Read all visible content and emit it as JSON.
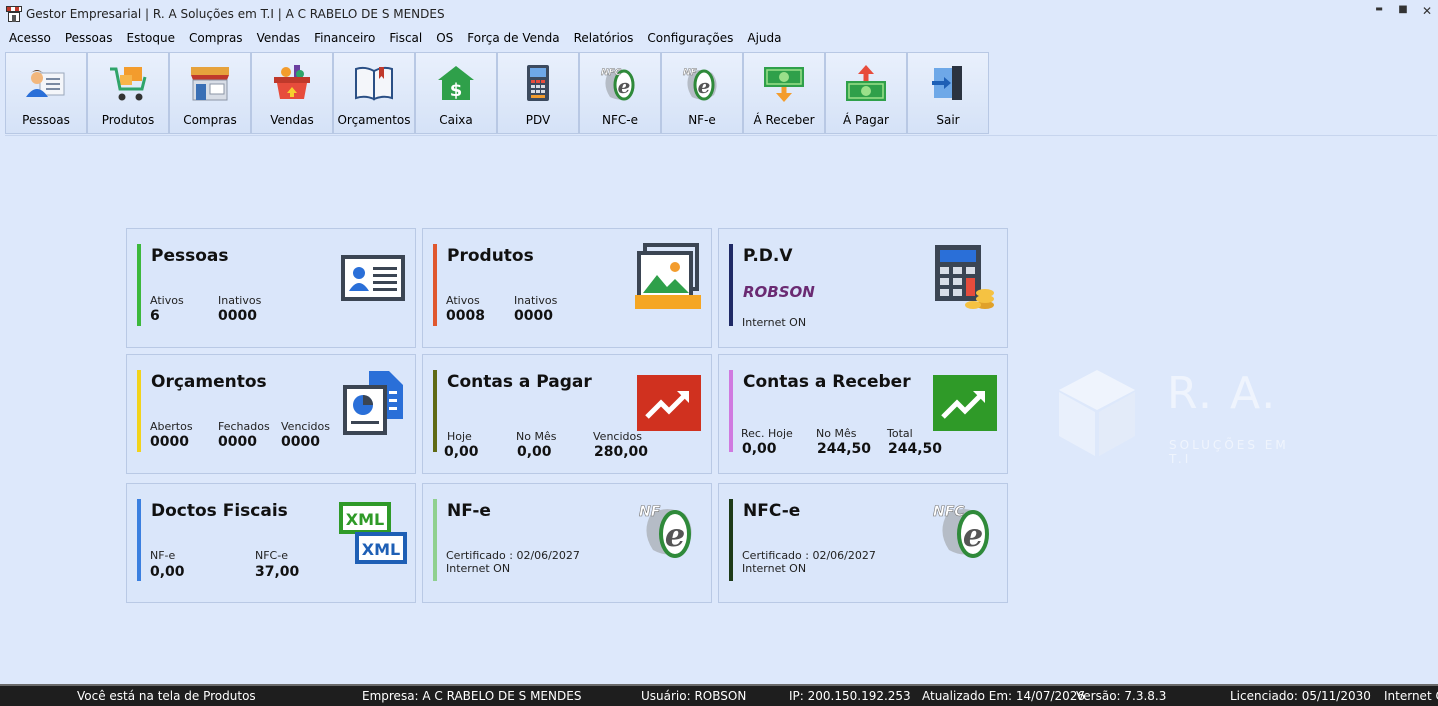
{
  "window": {
    "title": "Gestor Empresarial | R. A Soluções em T.I | A C RABELO DE S MENDES",
    "minimize": "▬",
    "maximize": "■",
    "close": "✕"
  },
  "menu": [
    "Acesso",
    "Pessoas",
    "Estoque",
    "Compras",
    "Vendas",
    "Financeiro",
    "Fiscal",
    "OS",
    "Força de Venda",
    "Relatórios",
    "Configurações",
    "Ajuda"
  ],
  "toolbar": [
    {
      "label": "Pessoas",
      "icon": "person-card-icon"
    },
    {
      "label": "Produtos",
      "icon": "shopping-cart-icon"
    },
    {
      "label": "Compras",
      "icon": "store-icon"
    },
    {
      "label": "Vendas",
      "icon": "basket-icon"
    },
    {
      "label": "Orçamentos",
      "icon": "book-icon"
    },
    {
      "label": "Caixa",
      "icon": "cash-house-icon"
    },
    {
      "label": "PDV",
      "icon": "pos-terminal-icon"
    },
    {
      "label": "NFC-e",
      "icon": "nfce-logo-icon"
    },
    {
      "label": "NF-e",
      "icon": "nfe-logo-icon"
    },
    {
      "label": "Á Receber",
      "icon": "receive-money-icon"
    },
    {
      "label": "Á Pagar",
      "icon": "pay-money-icon"
    },
    {
      "label": "Sair",
      "icon": "exit-icon"
    }
  ],
  "toolbar_logo_text": {
    "nfce": "NFC",
    "nfe": "NF",
    "e": "e"
  },
  "cards": {
    "pessoas": {
      "title": "Pessoas",
      "ativos_label": "Ativos",
      "ativos": "6",
      "inativos_label": "Inativos",
      "inativos": "0000",
      "color": "#3cb83c"
    },
    "produtos": {
      "title": "Produtos",
      "ativos_label": "Ativos",
      "ativos": "0008",
      "inativos_label": "Inativos",
      "inativos": "0000",
      "color": "#e0572e"
    },
    "pdv": {
      "title": "P.D.V",
      "user": "ROBSON",
      "internet": "Internet ON",
      "color": "#1f2a66"
    },
    "orcamentos": {
      "title": "Orçamentos",
      "abertos_label": "Abertos",
      "abertos": "0000",
      "fechados_label": "Fechados",
      "fechados": "0000",
      "vencidos_label": "Vencidos",
      "vencidos": "0000",
      "color": "#f2d31b"
    },
    "contas_pagar": {
      "title": "Contas a Pagar",
      "hoje_label": "Hoje",
      "hoje": "0,00",
      "mes_label": "No Mês",
      "mes": "0,00",
      "vencidos_label": "Vencidos",
      "vencidos": "280,00",
      "color": "#5f6a14"
    },
    "contas_receber": {
      "title": "Contas a Receber",
      "hoje_label": "Rec. Hoje",
      "hoje": "0,00",
      "mes_label": "No Mês",
      "mes": "244,50",
      "total_label": "Total",
      "total": "244,50",
      "color": "#d07ae0"
    },
    "doctos": {
      "title": "Doctos Fiscais",
      "nfe_label": "NF-e",
      "nfe": "0,00",
      "nfce_label": "NFC-e",
      "nfce": "37,00",
      "color": "#3a7fe0",
      "xml": "XML"
    },
    "nfe": {
      "title": "NF-e",
      "certificado": "Certificado : 02/06/2027",
      "internet": "Internet ON",
      "color": "#8fd08f"
    },
    "nfce": {
      "title": "NFC-e",
      "certificado": "Certificado : 02/06/2027",
      "internet": "Internet ON",
      "color": "#1d3a18"
    }
  },
  "watermark": {
    "text": "R. A.",
    "sub": "SOLUÇÕES EM T.I"
  },
  "status": {
    "screen": "Você está na tela de Produtos",
    "empresa": "Empresa: A C RABELO DE S MENDES",
    "usuario": "Usuário: ROBSON",
    "ip": "IP: 200.150.192.253",
    "atualizado": "Atualizado Em: 14/07/2026",
    "versao": "Versão: 7.3.8.3",
    "licenciado": "Licenciado: 05/11/2030",
    "internet": "Internet ON"
  }
}
